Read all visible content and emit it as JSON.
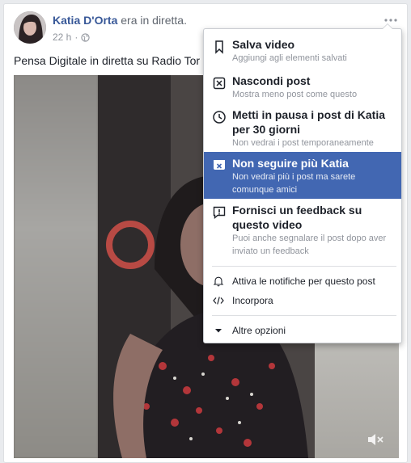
{
  "post": {
    "author_name": "Katia D'Orta",
    "action_text": "era in diretta.",
    "time": "22 h",
    "privacy_icon": "globe-icon",
    "text": "Pensa Digitale in diretta su Radio Tor",
    "more_icon": "more-dots-icon"
  },
  "video": {
    "mute_icon": "speaker-muted-icon"
  },
  "menu": {
    "items": [
      {
        "icon": "bookmark-icon",
        "title": "Salva video",
        "subtitle": "Aggiungi agli elementi salvati"
      },
      {
        "icon": "hide-x-icon",
        "title": "Nascondi post",
        "subtitle": "Mostra meno post come questo"
      },
      {
        "icon": "clock-icon",
        "title": "Metti in pausa i post di Katia per 30 giorni",
        "subtitle": "Non vedrai i post temporaneamente"
      },
      {
        "icon": "unfollow-icon",
        "title": "Non seguire più Katia",
        "subtitle": "Non vedrai più i post ma sarete comunque amici"
      },
      {
        "icon": "feedback-icon",
        "title": "Fornisci un feedback su questo video",
        "subtitle": "Puoi anche segnalare il post dopo aver inviato un feedback"
      }
    ],
    "secondary": [
      {
        "icon": "bell-icon",
        "label": "Attiva le notifiche per questo post"
      },
      {
        "icon": "embed-code-icon",
        "label": "Incorpora"
      }
    ],
    "more_options": {
      "icon": "triangle-down-icon",
      "label": "Altre opzioni"
    },
    "highlight_color": "#4267b2"
  }
}
